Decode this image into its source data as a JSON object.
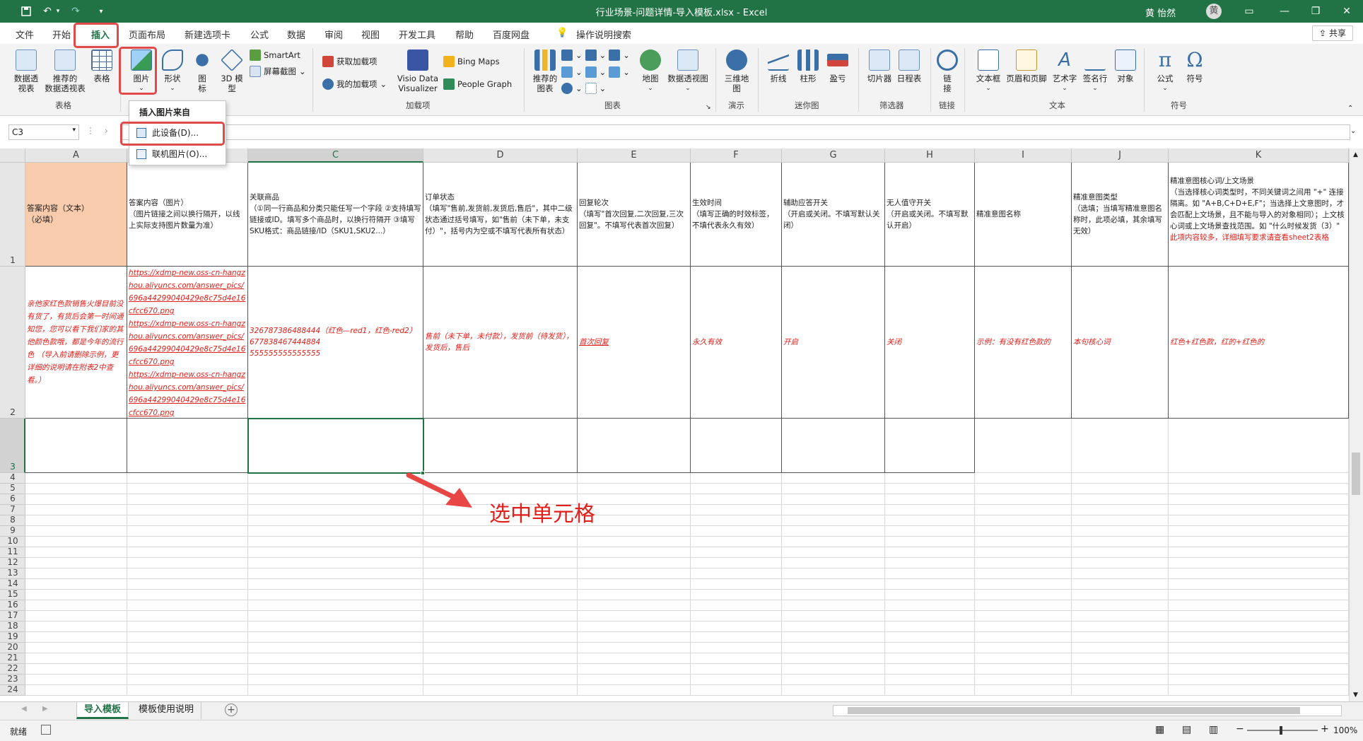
{
  "titlebar": {
    "title": "行业场景-问题详情-导入模板.xlsx  -  Excel",
    "user": "黄 怡然",
    "avatar_initial": "黄",
    "quick_access": [
      "save-icon",
      "undo-icon",
      "redo-icon",
      "customize-icon"
    ],
    "window_buttons": [
      "ribbon-display-icon",
      "minimize-icon",
      "restore-icon",
      "close-icon"
    ]
  },
  "menu": {
    "tabs": [
      "文件",
      "开始",
      "插入",
      "页面布局",
      "新建选项卡",
      "公式",
      "数据",
      "审阅",
      "视图",
      "开发工具",
      "帮助",
      "百度网盘"
    ],
    "active_tab": "插入",
    "tell_me": "操作说明搜索",
    "share": "共享"
  },
  "ribbon": {
    "tables": {
      "pivot": "数据透\n视表",
      "recommended_pivot": "推荐的\n数据透视表",
      "table": "表格",
      "group": "表格"
    },
    "illustrations": {
      "picture": "图片",
      "shapes": "形状",
      "icons": "图\n标",
      "model3d": "3D 模\n型",
      "smartart": "SmartArt",
      "screenshot": "屏幕截图"
    },
    "addins": {
      "get": "获取加载项",
      "mine": "我的加载项",
      "visio": "Visio Data\nVisualizer",
      "bing": "Bing Maps",
      "people": "People Graph",
      "group": "加载项"
    },
    "charts": {
      "recommended": "推荐的\n图表",
      "map": "地图",
      "pivotchart": "数据透视图",
      "group": "图表"
    },
    "tours": {
      "map3d": "三维地\n图",
      "group": "演示"
    },
    "sparklines": {
      "line": "折线",
      "column": "柱形",
      "winloss": "盈亏",
      "group": "迷你图"
    },
    "filters": {
      "slicer": "切片器",
      "timeline": "日程表",
      "group": "筛选器"
    },
    "links": {
      "link": "链\n接",
      "group": "链接"
    },
    "text": {
      "textbox": "文本框",
      "headerfooter": "页眉和页脚",
      "wordart": "艺术字",
      "signature": "签名行",
      "object": "对象",
      "group": "文本"
    },
    "symbols": {
      "equation": "公式",
      "symbol": "符号",
      "group": "符号"
    }
  },
  "dropdown": {
    "header": "插入图片来自",
    "items": [
      "此设备(D)...",
      "联机图片(O)..."
    ]
  },
  "formula": {
    "namebox": "C3",
    "fx": ""
  },
  "columns": [
    "A",
    "B",
    "C",
    "D",
    "E",
    "F",
    "G",
    "H",
    "I",
    "J",
    "K"
  ],
  "rows": [
    "1",
    "2",
    "3",
    "4",
    "5",
    "6",
    "7",
    "8",
    "9",
    "10",
    "11",
    "12",
    "13",
    "14",
    "15",
    "16",
    "17",
    "18",
    "19",
    "20",
    "21",
    "22",
    "23",
    "24"
  ],
  "row1": {
    "A": "答案内容（文本）\n（必填）",
    "B": "答案内容（图片）\n（图片链接之间以换行隔开，以线上实际支持图片数量为准）",
    "C": "关联商品\n（①同一行商品和分类只能任写一个字段 ②支持填写链接或ID。填写多个商品时，以换行符隔开 ③填写SKU格式：商品链接/ID（SKU1,SKU2...）",
    "D": "订单状态\n（填写\"售前,发货前,发货后,售后\"，其中二级状态通过括号填写，如\"售前（未下单，未支付）\"，括号内为空或不填写代表所有状态）",
    "E": "回复轮次\n（填写\"首次回复,二次回复,三次回复\"。不填写代表首次回复）",
    "F": "生效时间\n（填写正确的时效标签，不填代表永久有效）",
    "G": "辅助应答开关\n（开启或关闭。不填写默认关闭）",
    "H": "无人值守开关\n（开启或关闭。不填写默认开启）",
    "I": "精准意图名称",
    "J": "精准意图类型\n（选填；当填写精准意图名称时，此项必填，其余填写无效）",
    "K": "精准意图核心词/上文场景\n（当选择核心词类型时，不同关键词之间用 \"+\" 连接隔离。如 \"A+B,C+D+E,F\"；当选择上文意图时，才会匹配上文场景，且不能与导入的对象相同）；上文核心词或上文场景查找范围。如 \"什么时候发货（3）\"",
    "K_note": "此项内容较多，详细填写要求请查看sheet2表格"
  },
  "row2": {
    "A": "亲他家红色款销售火爆目前没有货了，有货后会第一时间通知您，您可以看下我们家的其他颜色款哦，都是今年的流行色   （导入前请删除示例，更详细的说明请在附表2中查看。）",
    "B": "https://xdmp-new.oss-cn-hangzhou.aliyuncs.com/answer_pics/696a44299040429e8c75d4e16cfcc670.png\nhttps://xdmp-new.oss-cn-hangzhou.aliyuncs.com/answer_pics/696a44299040429e8c75d4e16cfcc670.png\nhttps://xdmp-new.oss-cn-hangzhou.aliyuncs.com/answer_pics/696a44299040429e8c75d4e16cfcc670.png",
    "C": "326787386488444（红色—red1，红色-red2）\n677838467444884\n555555555555555",
    "D": "售前（未下单，未付款），发货前（待发货），发货后，售后",
    "E": "首次回复",
    "F": "永久有效",
    "G": "开启",
    "H": "关闭",
    "I": "示例：有没有红色款的",
    "J": "本句核心词",
    "K": "红色+红色款，红的+红色的"
  },
  "annotation": "选中单元格",
  "sheets": [
    "导入模板",
    "模板使用说明"
  ],
  "active_sheet": "导入模板",
  "status": {
    "ready": "就绪",
    "zoom": "100%"
  },
  "colors": {
    "excel_green": "#217346",
    "annotation_red": "#e0201b",
    "header_orange": "#f8cbad"
  }
}
